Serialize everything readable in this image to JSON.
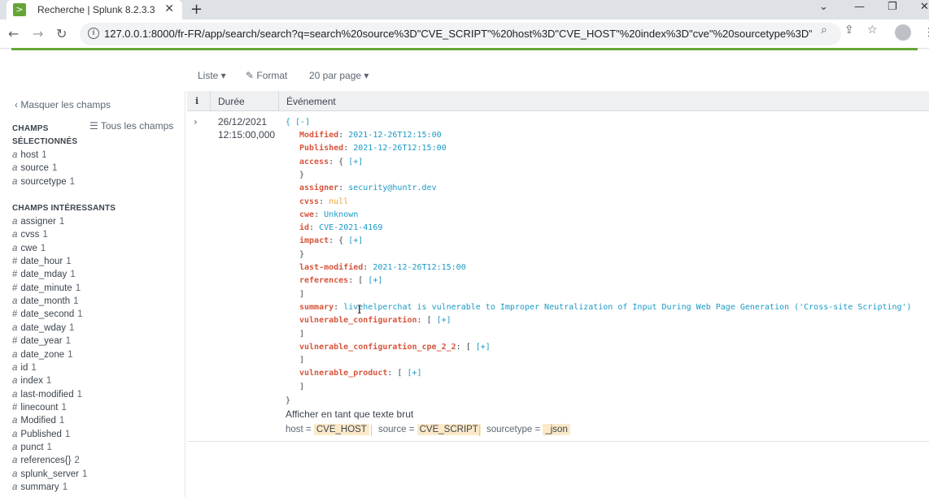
{
  "browser": {
    "tab_title": "Recherche | Splunk 8.2.3.3",
    "favicon_glyph": ">",
    "url": "127.0.0.1:8000/fr-FR/app/search/search?q=search%20source%3D\"CVE_SCRIPT\"%20host%3D\"CVE_HOST\"%20index%3D\"cve\"%20sourcetype%3D\"_json\"&e...",
    "icons": [
      "back-icon",
      "forward-icon",
      "reload-icon",
      "info-icon",
      "zoom-icon",
      "share-icon",
      "star-icon",
      "profile-icon",
      "kebab-icon"
    ]
  },
  "colors": {
    "accent_green": "#65a637",
    "key_red": "#d6563c",
    "string_blue": "#1a9ac5",
    "null_orange": "#e8a33d",
    "highlight": "#fbe9c8"
  },
  "controls": {
    "list": "Liste ▾",
    "format": "✎ Format",
    "per_page": "20 par page ▾"
  },
  "sidebar": {
    "hide_fields": "‹ Masquer les champs",
    "all_fields": "☰ Tous les champs",
    "selected_title_1": "CHAMPS",
    "selected_title_2": "SÉLECTIONNÉS",
    "selected": [
      {
        "type": "a",
        "name": "host",
        "count": "1"
      },
      {
        "type": "a",
        "name": "source",
        "count": "1"
      },
      {
        "type": "a",
        "name": "sourcetype",
        "count": "1"
      }
    ],
    "interesting_title": "CHAMPS INTÉRESSANTS",
    "interesting": [
      {
        "type": "a",
        "name": "assigner",
        "count": "1"
      },
      {
        "type": "a",
        "name": "cvss",
        "count": "1"
      },
      {
        "type": "a",
        "name": "cwe",
        "count": "1"
      },
      {
        "type": "#",
        "name": "date_hour",
        "count": "1"
      },
      {
        "type": "#",
        "name": "date_mday",
        "count": "1"
      },
      {
        "type": "#",
        "name": "date_minute",
        "count": "1"
      },
      {
        "type": "a",
        "name": "date_month",
        "count": "1"
      },
      {
        "type": "#",
        "name": "date_second",
        "count": "1"
      },
      {
        "type": "a",
        "name": "date_wday",
        "count": "1"
      },
      {
        "type": "#",
        "name": "date_year",
        "count": "1"
      },
      {
        "type": "a",
        "name": "date_zone",
        "count": "1"
      },
      {
        "type": "a",
        "name": "id",
        "count": "1"
      },
      {
        "type": "a",
        "name": "index",
        "count": "1"
      },
      {
        "type": "a",
        "name": "last-modified",
        "count": "1"
      },
      {
        "type": "#",
        "name": "linecount",
        "count": "1"
      },
      {
        "type": "a",
        "name": "Modified",
        "count": "1"
      },
      {
        "type": "a",
        "name": "Published",
        "count": "1"
      },
      {
        "type": "a",
        "name": "punct",
        "count": "1"
      },
      {
        "type": "a",
        "name": "references{}",
        "count": "2"
      },
      {
        "type": "a",
        "name": "splunk_server",
        "count": "1"
      },
      {
        "type": "a",
        "name": "summary",
        "count": "1"
      }
    ]
  },
  "results": {
    "col_i": "i",
    "col_time": "Durée",
    "col_event": "Événement",
    "event": {
      "date": "26/12/2021",
      "time": "12:15:00,000",
      "open": "{ [-]",
      "lines": [
        {
          "key": "Modified",
          "sep": ": ",
          "val": "2021-12-26T12:15:00",
          "kind": "str"
        },
        {
          "key": "Published",
          "sep": ": ",
          "val": "2021-12-26T12:15:00",
          "kind": "str"
        },
        {
          "key": "access",
          "sep": ": { ",
          "val": "[+]",
          "kind": "link"
        },
        {
          "key": "",
          "sep": "}",
          "val": "",
          "kind": "close"
        },
        {
          "key": "assigner",
          "sep": ": ",
          "val": "security@huntr.dev",
          "kind": "str"
        },
        {
          "key": "cvss",
          "sep": ": ",
          "val": "null",
          "kind": "null"
        },
        {
          "key": "cwe",
          "sep": ": ",
          "val": "Unknown",
          "kind": "str"
        },
        {
          "key": "id",
          "sep": ": ",
          "val": "CVE-2021-4169",
          "kind": "str"
        },
        {
          "key": "impact",
          "sep": ": { ",
          "val": "[+]",
          "kind": "link"
        },
        {
          "key": "",
          "sep": "}",
          "val": "",
          "kind": "close"
        },
        {
          "key": "last-modified",
          "sep": ": ",
          "val": "2021-12-26T12:15:00",
          "kind": "str"
        },
        {
          "key": "references",
          "sep": ": [ ",
          "val": "[+]",
          "kind": "link"
        },
        {
          "key": "",
          "sep": "]",
          "val": "",
          "kind": "close"
        },
        {
          "key": "summary",
          "sep": ": ",
          "val": "livehelperchat is vulnerable to Improper Neutralization of Input During Web Page Generation ('Cross-site Scripting')",
          "kind": "str"
        },
        {
          "key": "vulnerable_configuration",
          "sep": ": [ ",
          "val": "[+]",
          "kind": "link"
        },
        {
          "key": "",
          "sep": "]",
          "val": "",
          "kind": "close"
        },
        {
          "key": "vulnerable_configuration_cpe_2_2",
          "sep": ": [ ",
          "val": "[+]",
          "kind": "link"
        },
        {
          "key": "",
          "sep": "]",
          "val": "",
          "kind": "close"
        },
        {
          "key": "vulnerable_product",
          "sep": ": [ ",
          "val": "[+]",
          "kind": "link"
        },
        {
          "key": "",
          "sep": "]",
          "val": "",
          "kind": "close"
        }
      ],
      "close": "}",
      "raw_link": "Afficher en tant que texte brut",
      "meta": [
        {
          "label": "host = ",
          "value": "CVE_HOST"
        },
        {
          "label": "source = ",
          "value": "CVE_SCRIPT"
        },
        {
          "label": "sourcetype = ",
          "value": "_json"
        }
      ]
    }
  }
}
